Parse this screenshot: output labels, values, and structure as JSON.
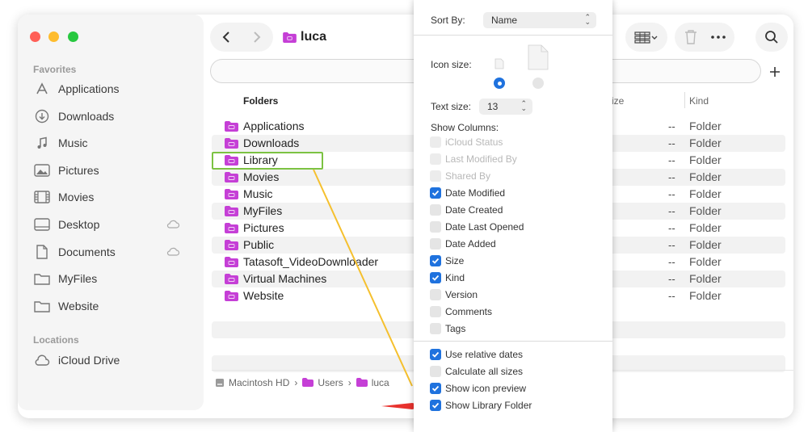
{
  "sidebar": {
    "favorites_label": "Favorites",
    "locations_label": "Locations",
    "favorites": [
      {
        "label": "Applications",
        "icon": "applications-icon"
      },
      {
        "label": "Downloads",
        "icon": "downloads-icon"
      },
      {
        "label": "Music",
        "icon": "music-icon"
      },
      {
        "label": "Pictures",
        "icon": "pictures-icon"
      },
      {
        "label": "Movies",
        "icon": "movies-icon"
      },
      {
        "label": "Desktop",
        "icon": "desktop-icon",
        "cloud": true
      },
      {
        "label": "Documents",
        "icon": "documents-icon",
        "cloud": true
      },
      {
        "label": "MyFiles",
        "icon": "folder-icon"
      },
      {
        "label": "Website",
        "icon": "folder-icon"
      }
    ],
    "locations": [
      {
        "label": "iCloud Drive",
        "icon": "cloud-icon"
      }
    ]
  },
  "toolbar": {
    "title": "luca"
  },
  "list": {
    "col_folders": "Folders",
    "col_size": "ize",
    "col_kind": "Kind",
    "rows": [
      {
        "name": "Applications",
        "size": "--",
        "kind": "Folder"
      },
      {
        "name": "Downloads",
        "size": "--",
        "kind": "Folder"
      },
      {
        "name": "Library",
        "size": "--",
        "kind": "Folder"
      },
      {
        "name": "Movies",
        "size": "--",
        "kind": "Folder"
      },
      {
        "name": "Music",
        "size": "--",
        "kind": "Folder"
      },
      {
        "name": "MyFiles",
        "size": "--",
        "kind": "Folder"
      },
      {
        "name": "Pictures",
        "size": "--",
        "kind": "Folder"
      },
      {
        "name": "Public",
        "size": "--",
        "kind": "Folder"
      },
      {
        "name": "Tatasoft_VideoDownloader",
        "size": "--",
        "kind": "Folder"
      },
      {
        "name": "Virtual Machines",
        "size": "--",
        "kind": "Folder"
      },
      {
        "name": "Website",
        "size": "--",
        "kind": "Folder"
      }
    ]
  },
  "pathbar": {
    "items": [
      "Macintosh HD",
      "Users",
      "luca"
    ]
  },
  "view_options": {
    "sort_by_label": "Sort By:",
    "sort_by_value": "Name",
    "icon_size_label": "Icon size:",
    "text_size_label": "Text size:",
    "text_size_value": "13",
    "show_columns_label": "Show Columns:",
    "columns": [
      {
        "label": "iCloud Status",
        "state": "disabled"
      },
      {
        "label": "Last Modified By",
        "state": "disabled"
      },
      {
        "label": "Shared By",
        "state": "disabled"
      },
      {
        "label": "Date Modified",
        "state": "checked"
      },
      {
        "label": "Date Created",
        "state": "unchecked"
      },
      {
        "label": "Date Last Opened",
        "state": "unchecked"
      },
      {
        "label": "Date Added",
        "state": "unchecked"
      },
      {
        "label": "Size",
        "state": "checked"
      },
      {
        "label": "Kind",
        "state": "checked"
      },
      {
        "label": "Version",
        "state": "unchecked"
      },
      {
        "label": "Comments",
        "state": "unchecked"
      },
      {
        "label": "Tags",
        "state": "unchecked"
      }
    ],
    "options": [
      {
        "label": "Use relative dates",
        "state": "checked"
      },
      {
        "label": "Calculate all sizes",
        "state": "unchecked"
      },
      {
        "label": "Show icon preview",
        "state": "checked"
      },
      {
        "label": "Show Library Folder",
        "state": "checked"
      }
    ]
  },
  "colors": {
    "accent": "#1f72de",
    "folder": "#c53fd6",
    "highlight": "#7cc242",
    "annotation_line": "#f5c02e",
    "annotation_arrow": "#e8322e"
  }
}
